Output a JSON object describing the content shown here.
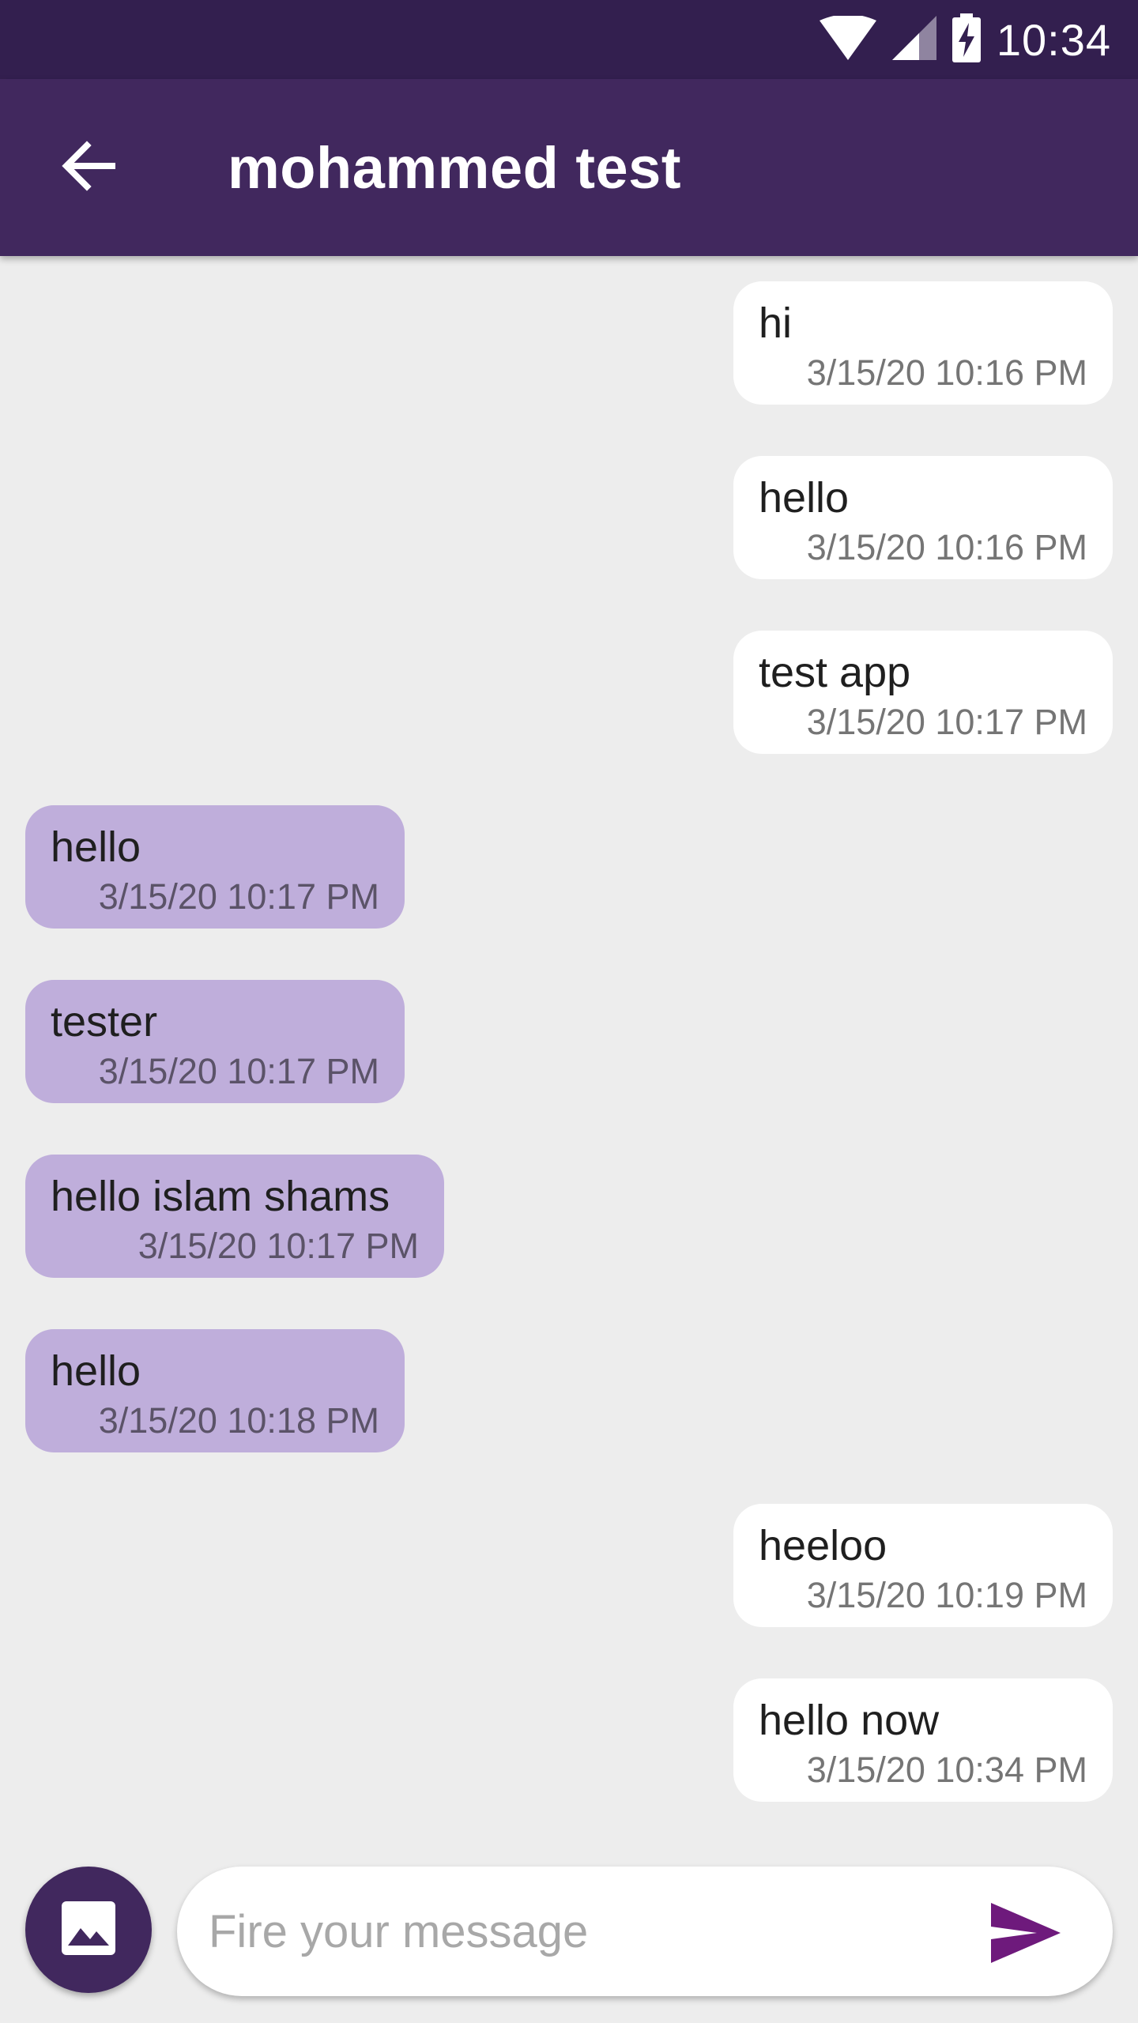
{
  "status_bar": {
    "time": "10:34",
    "icons": [
      "wifi-icon",
      "cell-signal-icon",
      "battery-charging-icon"
    ]
  },
  "app_bar": {
    "back_icon": "arrow-back-icon",
    "title": "mohammed test",
    "color": "#41285e"
  },
  "messages": [
    {
      "direction": "outgoing",
      "text": "hi",
      "time": "3/15/20 10:16 PM"
    },
    {
      "direction": "outgoing",
      "text": "hello",
      "time": "3/15/20 10:16 PM"
    },
    {
      "direction": "outgoing",
      "text": "test app",
      "time": "3/15/20 10:17 PM"
    },
    {
      "direction": "incoming",
      "text": "hello",
      "time": "3/15/20 10:17 PM"
    },
    {
      "direction": "incoming",
      "text": "tester",
      "time": "3/15/20 10:17 PM"
    },
    {
      "direction": "incoming",
      "text": "hello islam shams",
      "time": "3/15/20 10:17 PM"
    },
    {
      "direction": "incoming",
      "text": "hello",
      "time": "3/15/20 10:18 PM"
    },
    {
      "direction": "outgoing",
      "text": "heeloo",
      "time": "3/15/20 10:19 PM"
    },
    {
      "direction": "outgoing",
      "text": "hello now",
      "time": "3/15/20 10:34 PM"
    }
  ],
  "composer": {
    "image_icon": "image-icon",
    "placeholder": "Fire your message",
    "value": "",
    "send_icon": "send-icon"
  },
  "colors": {
    "status_bar": "#331f4f",
    "incoming_bubble": "#bfaedb",
    "outgoing_bubble": "#ffffff",
    "background": "#ededed",
    "send_accent": "#6e1a7c"
  }
}
